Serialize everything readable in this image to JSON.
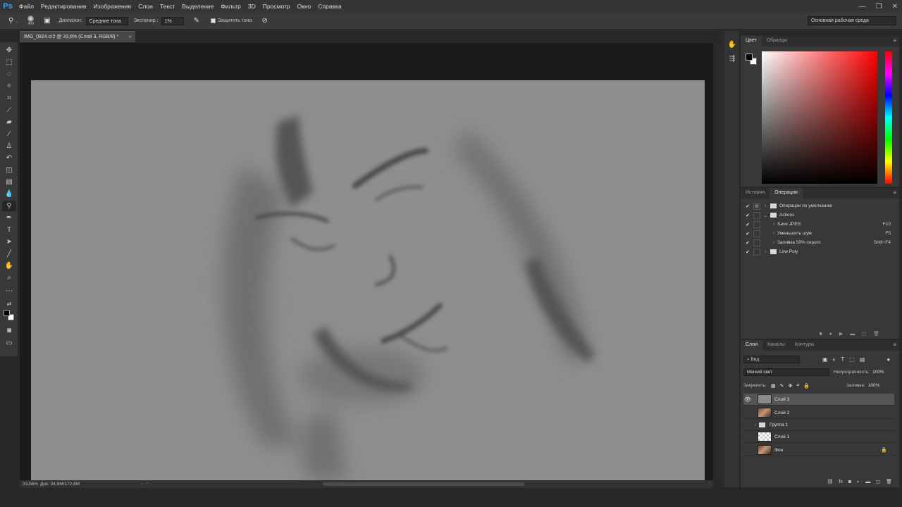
{
  "app": {
    "logo": "Ps"
  },
  "menu": [
    "Файл",
    "Редактирование",
    "Изображение",
    "Слои",
    "Текст",
    "Выделение",
    "Фильтр",
    "3D",
    "Просмотр",
    "Окно",
    "Справка"
  ],
  "window_controls": {
    "minimize": "—",
    "maximize": "❐",
    "close": "✕"
  },
  "options": {
    "brush_size": "400",
    "range_label": "Диапазон:",
    "range_value": "Средние тона",
    "exposure_label": "Экспонир.:",
    "exposure_value": "1%",
    "protect_tones": "Защитить тона",
    "workspace": "Основная рабочая среда"
  },
  "document": {
    "tab_title": "IMG_0924.cr2 @ 33,6% (Слой 3, RGB/8) *",
    "close": "×"
  },
  "status": {
    "zoom": "33,56%",
    "doc_size": "Док: 34,8М/172,8М"
  },
  "panels": {
    "color_tabs": [
      "Цвет",
      "Образцы"
    ],
    "actions_tabs": [
      "История",
      "Операции"
    ],
    "layers_tabs": [
      "Слои",
      "Каналы",
      "Контуры"
    ]
  },
  "actions": [
    {
      "name": "Операции по умолчанию",
      "key": "",
      "type": "set",
      "indent": 0
    },
    {
      "name": "Actions",
      "key": "",
      "type": "set-open",
      "indent": 0
    },
    {
      "name": "Save JPEG",
      "key": "F10",
      "type": "action",
      "indent": 1
    },
    {
      "name": "Уменьшить шум",
      "key": "F5",
      "type": "action",
      "indent": 1
    },
    {
      "name": "Заливка 50% серого",
      "key": "Shift+F4",
      "type": "action",
      "indent": 1
    },
    {
      "name": "Low Poly",
      "key": "",
      "type": "set",
      "indent": 0
    }
  ],
  "layers_ui": {
    "filter": "Вид",
    "blend_mode": "Мягкий свет",
    "opacity_label": "Непрозрачность:",
    "opacity_value": "100%",
    "lock_label": "Закрепить:",
    "fill_label": "Заливка:",
    "fill_value": "100%"
  },
  "layers": [
    {
      "name": "Слой 3",
      "thumb": "gray",
      "visible": true,
      "selected": true
    },
    {
      "name": "Слой 2",
      "thumb": "photo",
      "visible": false,
      "selected": false
    },
    {
      "name": "Группа 1",
      "thumb": "group",
      "visible": false,
      "selected": false
    },
    {
      "name": "Слой 1",
      "thumb": "checker",
      "visible": false,
      "selected": false
    },
    {
      "name": "Фон",
      "thumb": "photo",
      "visible": false,
      "selected": false,
      "locked": true
    }
  ]
}
